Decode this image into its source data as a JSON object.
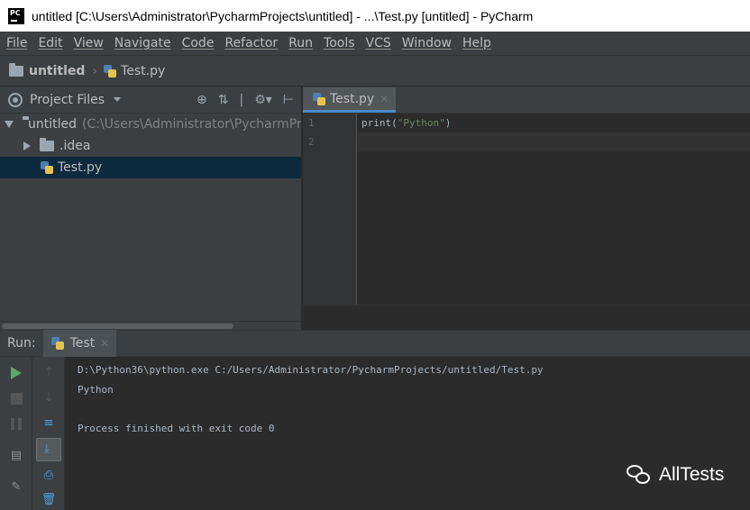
{
  "window": {
    "app_logo_text": "PC",
    "title": "untitled [C:\\Users\\Administrator\\PycharmProjects\\untitled] - ...\\Test.py [untitled] - PyCharm"
  },
  "menu": [
    "File",
    "Edit",
    "View",
    "Navigate",
    "Code",
    "Refactor",
    "Run",
    "Tools",
    "VCS",
    "Window",
    "Help"
  ],
  "breadcrumb": {
    "project": "untitled",
    "file": "Test.py"
  },
  "project_panel": {
    "view_selector": "Project Files",
    "tree": [
      {
        "label": "untitled",
        "path": "(C:\\Users\\Administrator\\PycharmProjects\\untitled)"
      },
      {
        "label": ".idea"
      },
      {
        "label": "Test.py"
      }
    ]
  },
  "editor": {
    "tab_label": "Test.py",
    "line_numbers": [
      "1",
      "2"
    ],
    "code": {
      "fn": "print",
      "open": "(",
      "string": "\"Python\"",
      "close": ")"
    }
  },
  "run_panel": {
    "label": "Run:",
    "tab_label": "Test",
    "console": [
      "D:\\Python36\\python.exe C:/Users/Administrator/PycharmProjects/untitled/Test.py",
      "Python",
      "",
      "Process finished with exit code 0"
    ]
  },
  "watermark": {
    "text": "AllTests"
  },
  "colors": {
    "run_green": "#59a869",
    "selection": "#0d293e",
    "tab_underline": "#4a88c7",
    "string_green": "#6a8759"
  },
  "icons": [
    "pycharm-logo",
    "folder-icon",
    "python-file-icon",
    "target-icon",
    "collapse-icon",
    "gear-icon",
    "hide-icon",
    "play-icon",
    "stop-icon",
    "pause-icon",
    "up-arrow-icon",
    "down-arrow-icon",
    "soft-wrap-icon",
    "scroll-to-end-icon",
    "print-icon",
    "trash-icon",
    "layout-icon",
    "pin-icon",
    "close-icon"
  ]
}
